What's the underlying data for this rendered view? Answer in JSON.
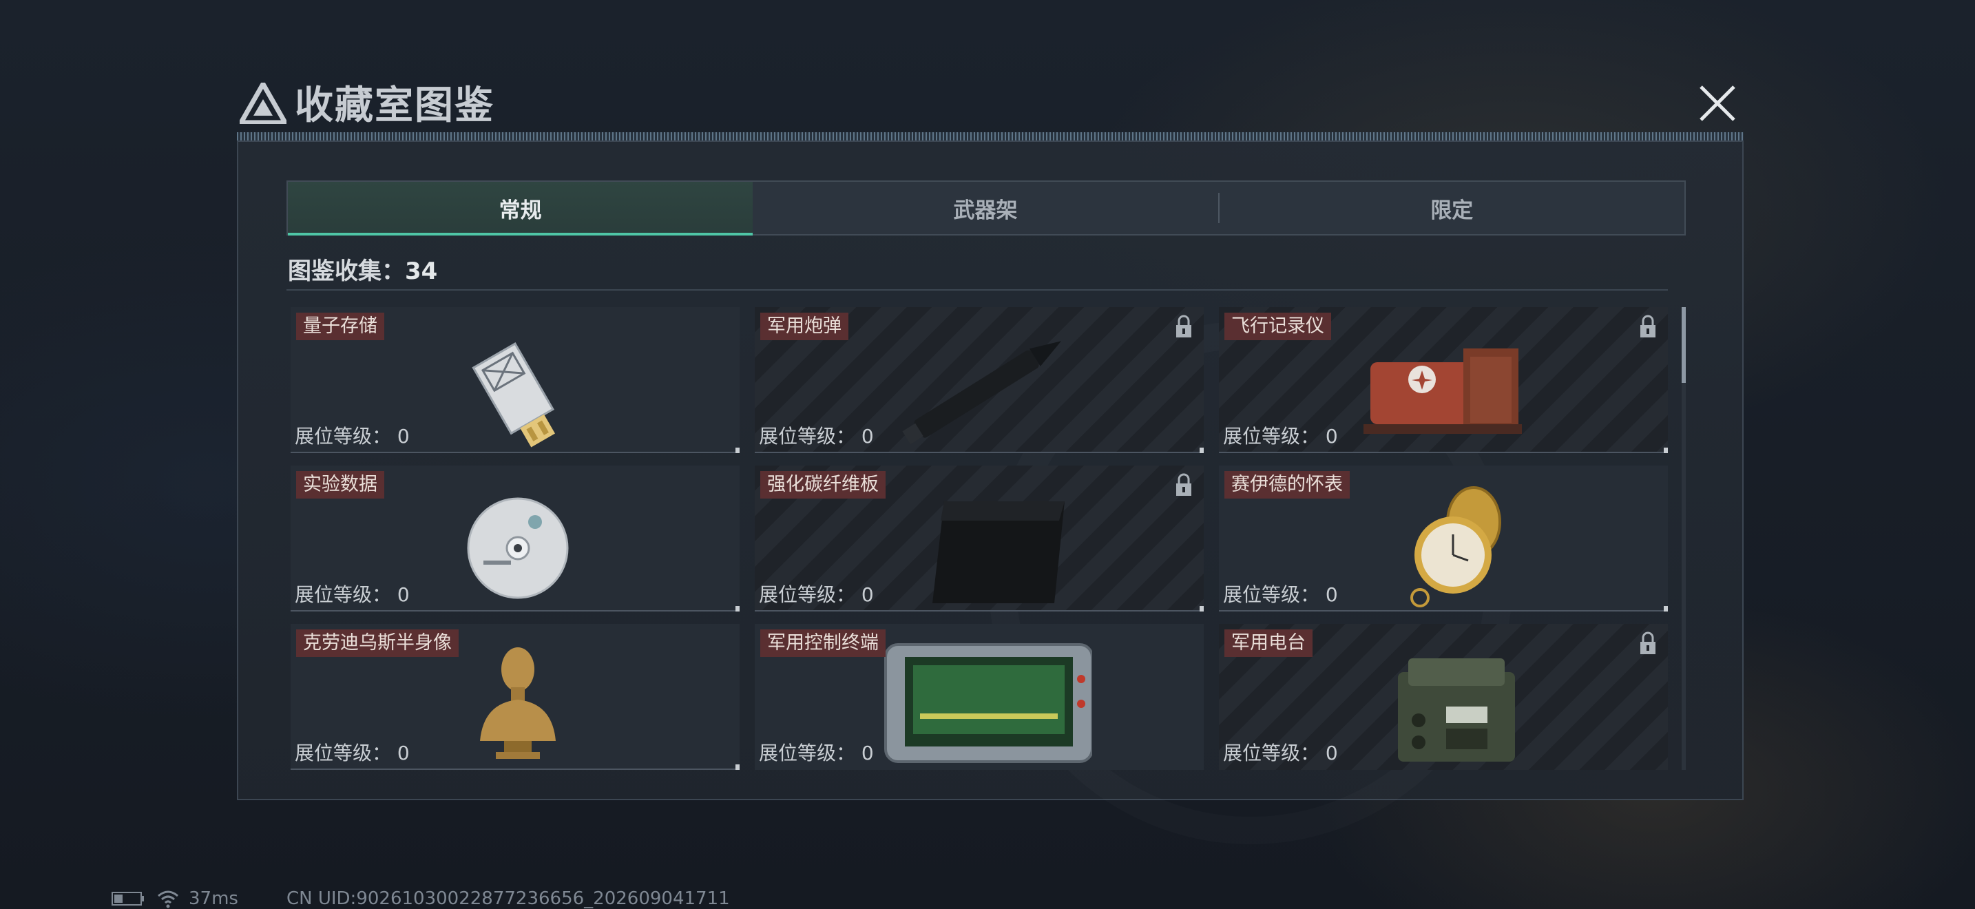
{
  "header": {
    "title": "收藏室图鉴",
    "tiny_text": "collection_codex_ui"
  },
  "tabs": [
    {
      "label": "常规",
      "active": true
    },
    {
      "label": "武器架",
      "active": false
    },
    {
      "label": "限定",
      "active": false
    }
  ],
  "collection": {
    "label": "图鉴收集：",
    "count": "34"
  },
  "items": [
    {
      "name": "量子存储",
      "level_label": "展位等级：",
      "level": "0",
      "locked": false,
      "icon": "usb-drive-icon"
    },
    {
      "name": "军用炮弹",
      "level_label": "展位等级：",
      "level": "0",
      "locked": true,
      "icon": "artillery-shell-icon"
    },
    {
      "name": "飞行记录仪",
      "level_label": "展位等级：",
      "level": "0",
      "locked": true,
      "icon": "flight-recorder-icon"
    },
    {
      "name": "实验数据",
      "level_label": "展位等级：",
      "level": "0",
      "locked": false,
      "icon": "disc-icon"
    },
    {
      "name": "强化碳纤维板",
      "level_label": "展位等级：",
      "level": "0",
      "locked": true,
      "icon": "carbon-plate-icon"
    },
    {
      "name": "赛伊德的怀表",
      "level_label": "展位等级：",
      "level": "0",
      "locked": false,
      "icon": "pocket-watch-icon"
    },
    {
      "name": "克劳迪乌斯半身像",
      "level_label": "展位等级：",
      "level": "0",
      "locked": false,
      "icon": "bust-icon"
    },
    {
      "name": "军用控制终端",
      "level_label": "展位等级：",
      "level": "0",
      "locked": false,
      "icon": "control-terminal-icon"
    },
    {
      "name": "军用电台",
      "level_label": "展位等级：",
      "level": "0",
      "locked": true,
      "icon": "radio-icon"
    }
  ],
  "status": {
    "ping": "37ms",
    "uid": "CN UID:90261030022877236656_202609041711"
  },
  "colors": {
    "accent": "#4fc6a6",
    "name_tag": "#5a2f31",
    "panel": "#242b34"
  }
}
